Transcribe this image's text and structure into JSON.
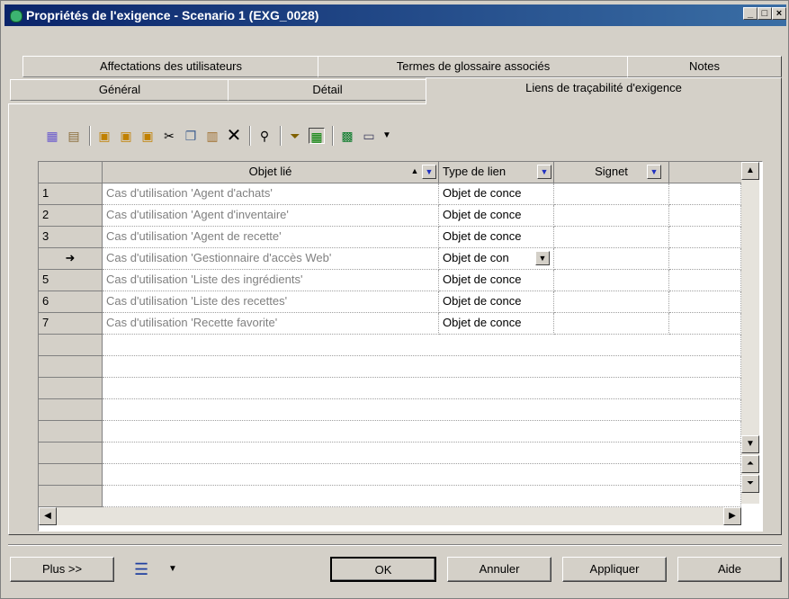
{
  "window": {
    "title": "Propriétés de l'exigence - Scenario 1 (EXG_0028)",
    "controls": [
      "_",
      "□",
      "×"
    ]
  },
  "tabs": {
    "row1": [
      "Affectations des utilisateurs",
      "Termes de glossaire associés",
      "Notes"
    ],
    "row2": [
      "Général",
      "Détail",
      "Liens de traçabilité d'exigence"
    ],
    "active": "Liens de traçabilité d'exigence"
  },
  "toolbar": {
    "icons": [
      "properties-icon",
      "open-icon",
      "add-objects-icon",
      "create-object-icon",
      "link-icon",
      "cut-icon",
      "copy-icon",
      "paste-icon",
      "delete-icon",
      "find-icon",
      "filter-icon",
      "customize-columns-icon",
      "excel-icon",
      "print-icon",
      "dropdown-arrow-icon"
    ]
  },
  "grid": {
    "columns": [
      {
        "label": "Objet lié"
      },
      {
        "label": "Type de lien"
      },
      {
        "label": "Signet"
      }
    ],
    "rows": [
      {
        "num": "1",
        "object": "Cas d'utilisation 'Agent d'achats'",
        "type": "Objet de conce",
        "bookmark": ""
      },
      {
        "num": "2",
        "object": "Cas d'utilisation 'Agent d'inventaire'",
        "type": "Objet de conce",
        "bookmark": ""
      },
      {
        "num": "3",
        "object": "Cas d'utilisation 'Agent de recette'",
        "type": "Objet de conce",
        "bookmark": ""
      },
      {
        "num": "➜",
        "object": "Cas d'utilisation 'Gestionnaire d'accès Web'",
        "type": "Objet de con",
        "bookmark": ""
      },
      {
        "num": "5",
        "object": "Cas d'utilisation 'Liste des ingrédients'",
        "type": "Objet de conce",
        "bookmark": ""
      },
      {
        "num": "6",
        "object": "Cas d'utilisation 'Liste des recettes'",
        "type": "Objet de conce",
        "bookmark": ""
      },
      {
        "num": "7",
        "object": "Cas d'utilisation 'Recette favorite'",
        "type": "Objet de conce",
        "bookmark": ""
      }
    ]
  },
  "buttons": {
    "more": "Plus >>",
    "ok": "OK",
    "cancel": "Annuler",
    "apply": "Appliquer",
    "help": "Aide"
  }
}
